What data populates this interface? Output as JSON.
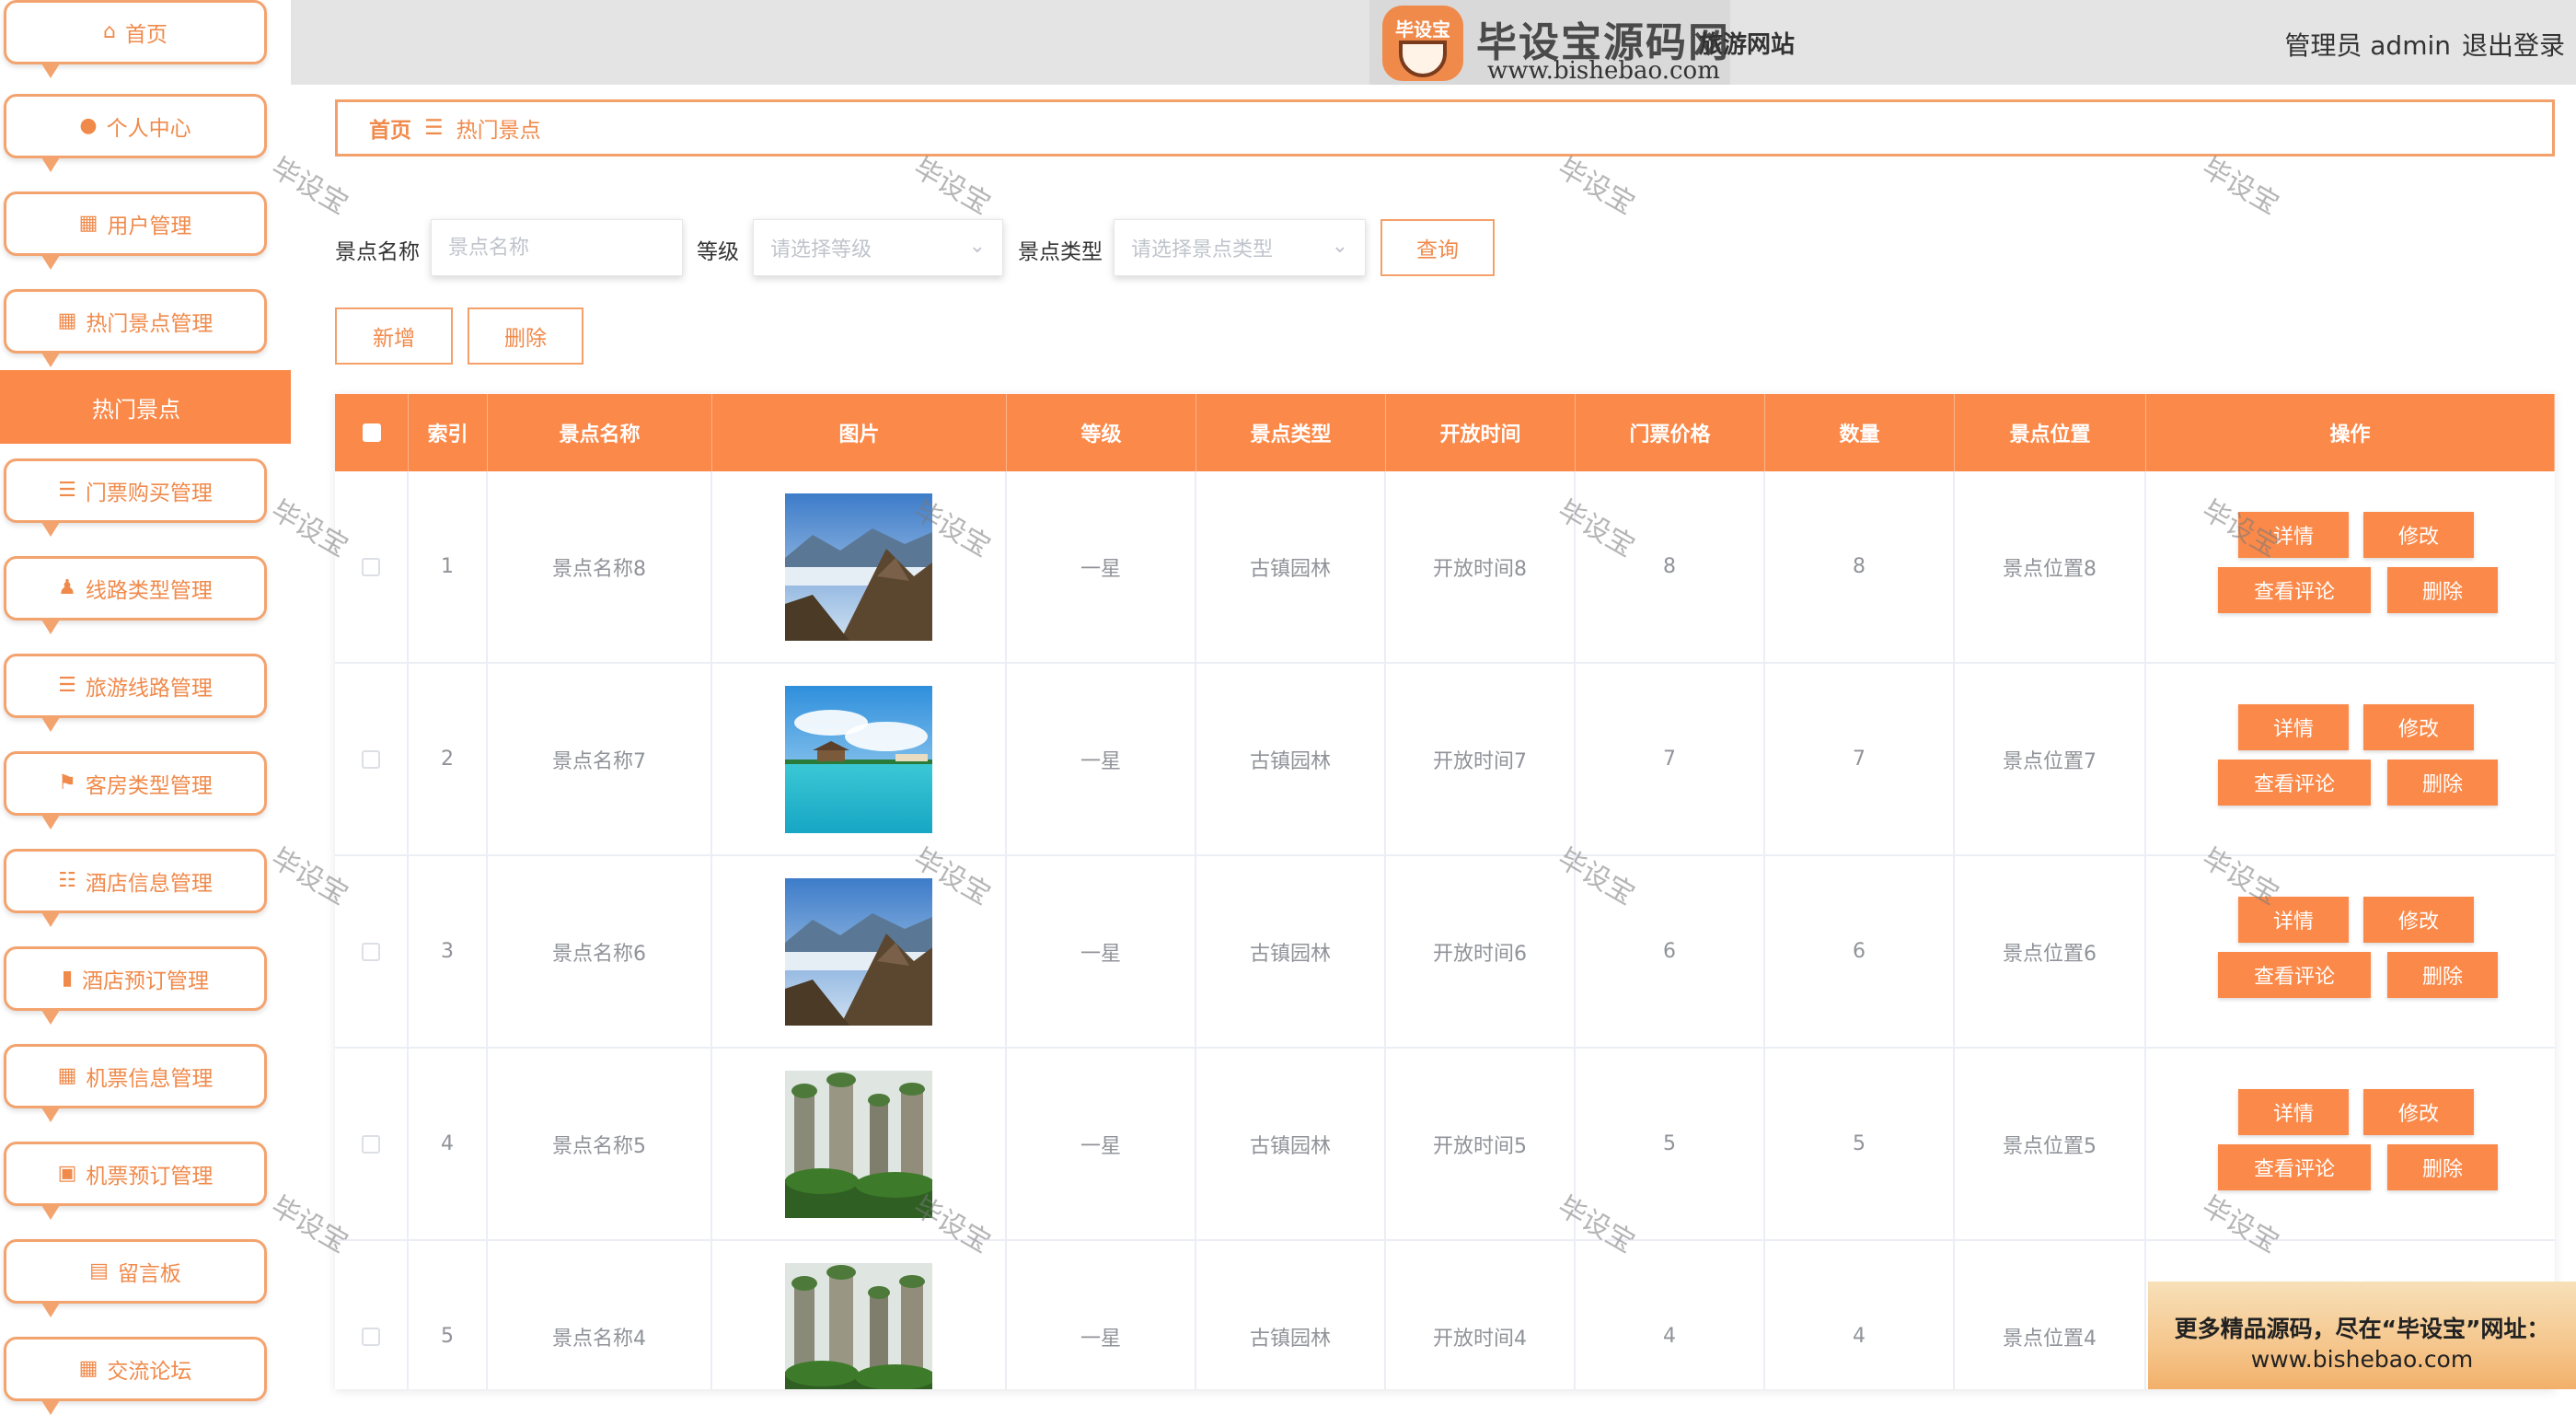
{
  "header": {
    "logo_badge": "毕设宝",
    "logo_title": "毕设宝源码网",
    "logo_url": "www.bishebao.com",
    "site_name": "旅游网站",
    "admin_label": "管理员 admin",
    "logout_label": "退出登录"
  },
  "sidebar": {
    "items": [
      {
        "label": "首页",
        "icon": "home-icon"
      },
      {
        "label": "个人中心",
        "icon": "user-icon"
      },
      {
        "label": "用户管理",
        "icon": "grid-icon"
      },
      {
        "label": "热门景点管理",
        "icon": "grid-icon"
      },
      {
        "label": "门票购买管理",
        "icon": "list-icon"
      },
      {
        "label": "线路类型管理",
        "icon": "person-icon"
      },
      {
        "label": "旅游线路管理",
        "icon": "list-icon"
      },
      {
        "label": "客房类型管理",
        "icon": "flag-icon"
      },
      {
        "label": "酒店信息管理",
        "icon": "sliders-icon"
      },
      {
        "label": "酒店预订管理",
        "icon": "bar-chart-icon"
      },
      {
        "label": "机票信息管理",
        "icon": "grid-icon"
      },
      {
        "label": "机票预订管理",
        "icon": "briefcase-icon"
      },
      {
        "label": "留言板",
        "icon": "clipboard-icon"
      },
      {
        "label": "交流论坛",
        "icon": "grid-icon"
      }
    ],
    "active_sub": "热门景点"
  },
  "breadcrumb": {
    "home": "首页",
    "separator": "☰",
    "current": "热门景点"
  },
  "search": {
    "name_label": "景点名称",
    "name_placeholder": "景点名称",
    "level_label": "等级",
    "level_placeholder": "请选择等级",
    "type_label": "景点类型",
    "type_placeholder": "请选择景点类型",
    "query_button": "查询"
  },
  "actions": {
    "add_button": "新增",
    "delete_button": "删除"
  },
  "table": {
    "headers": [
      "索引",
      "景点名称",
      "图片",
      "等级",
      "景点类型",
      "开放时间",
      "门票价格",
      "数量",
      "景点位置",
      "操作"
    ],
    "rows": [
      {
        "index": "1",
        "name": "景点名称8",
        "image": "mountain",
        "level": "一星",
        "type": "古镇园林",
        "open_time": "开放时间8",
        "price": "8",
        "count": "8",
        "location": "景点位置8"
      },
      {
        "index": "2",
        "name": "景点名称7",
        "image": "beach",
        "level": "一星",
        "type": "古镇园林",
        "open_time": "开放时间7",
        "price": "7",
        "count": "7",
        "location": "景点位置7"
      },
      {
        "index": "3",
        "name": "景点名称6",
        "image": "mountain",
        "level": "一星",
        "type": "古镇园林",
        "open_time": "开放时间6",
        "price": "6",
        "count": "6",
        "location": "景点位置6"
      },
      {
        "index": "4",
        "name": "景点名称5",
        "image": "pillars",
        "level": "一星",
        "type": "古镇园林",
        "open_time": "开放时间5",
        "price": "5",
        "count": "5",
        "location": "景点位置5"
      },
      {
        "index": "5",
        "name": "景点名称4",
        "image": "pillars",
        "level": "一星",
        "type": "古镇园林",
        "open_time": "开放时间4",
        "price": "4",
        "count": "4",
        "location": "景点位置4"
      }
    ],
    "row_buttons": {
      "detail": "详情",
      "edit": "修改",
      "comments": "查看评论",
      "delete": "删除"
    }
  },
  "watermark": "毕设宝",
  "promo": {
    "line1": "更多精品源码，尽在“毕设宝”网址：",
    "line2": "www.bishebao.com"
  },
  "colors": {
    "accent": "#fb8a4a",
    "accent_border": "#f4a06a",
    "topbar": "#e4e4e4"
  }
}
